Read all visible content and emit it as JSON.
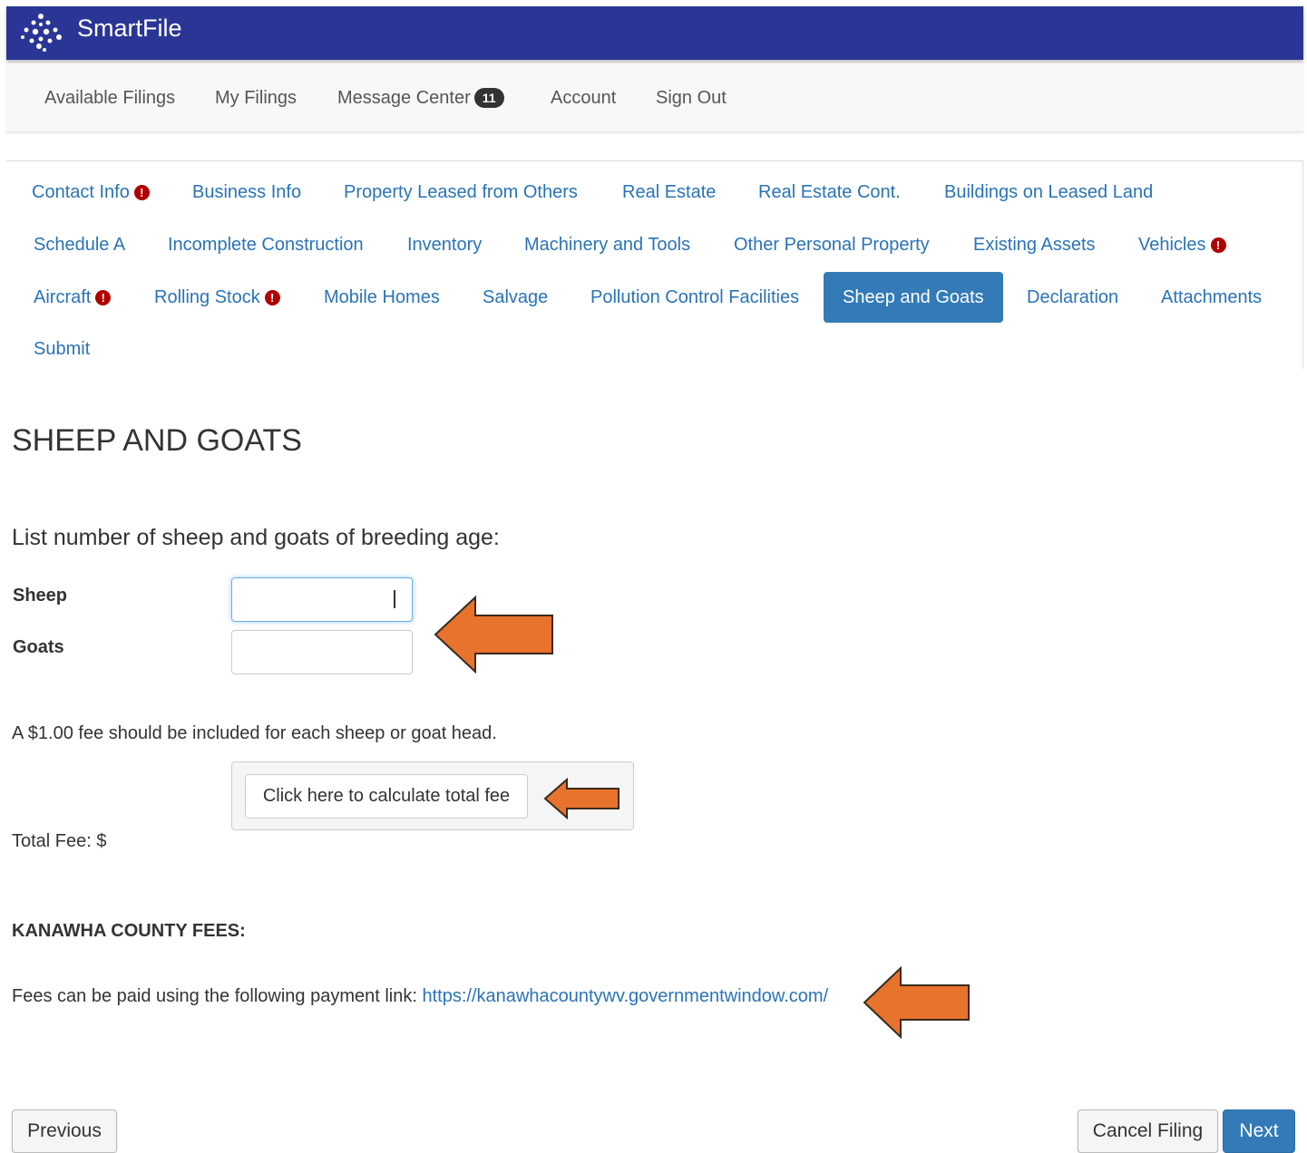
{
  "header": {
    "brand": "SmartFile",
    "logo_icon": "dots-diamond-logo-icon"
  },
  "mainnav": {
    "available_filings": "Available Filings",
    "my_filings": "My Filings",
    "message_center": "Message Center",
    "message_count": "11",
    "account": "Account",
    "sign_out": "Sign Out"
  },
  "tabs": {
    "contact_info": "Contact Info",
    "business_info": "Business Info",
    "property_leased": "Property Leased from Others",
    "real_estate": "Real Estate",
    "real_estate_cont": "Real Estate Cont.",
    "buildings_leased_land": "Buildings on Leased Land",
    "schedule_a": "Schedule A",
    "incomplete_construction": "Incomplete Construction",
    "inventory": "Inventory",
    "machinery_tools": "Machinery and Tools",
    "other_personal_property": "Other Personal Property",
    "existing_assets": "Existing Assets",
    "vehicles": "Vehicles",
    "aircraft": "Aircraft",
    "rolling_stock": "Rolling Stock",
    "mobile_homes": "Mobile Homes",
    "salvage": "Salvage",
    "pollution_control": "Pollution Control Facilities",
    "sheep_goats": "Sheep and Goats",
    "declaration": "Declaration",
    "attachments": "Attachments",
    "submit": "Submit",
    "warning_glyph": "!",
    "warning_color": "#b00000",
    "active_color": "#337ab7"
  },
  "main": {
    "title": "SHEEP AND GOATS",
    "intro": "List number of sheep and goats of breeding age:",
    "sheep_label": "Sheep",
    "sheep_value": "",
    "goats_label": "Goats",
    "goats_value": "",
    "fee_note": "A $1.00 fee should be included for each sheep or goat head.",
    "calc_button": "Click here to calculate total fee",
    "total_fee_label": "Total Fee: $",
    "county_heading": "KANAWHA COUNTY FEES:",
    "pay_text": "Fees can be paid using the following payment link: ",
    "pay_link": "https://kanawhacountywv.governmentwindow.com/"
  },
  "footer": {
    "previous": "Previous",
    "cancel": "Cancel Filing",
    "next": "Next"
  },
  "annotations": {
    "arrow_color": "#e8732d"
  }
}
